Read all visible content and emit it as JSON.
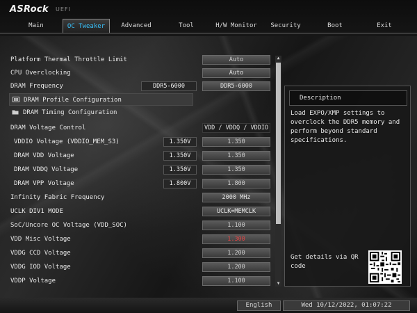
{
  "header": {
    "logo": "ASRock",
    "uefi": "UEFI"
  },
  "tabs": [
    {
      "label": "Main"
    },
    {
      "label": "OC Tweaker",
      "active": true
    },
    {
      "label": "Advanced"
    },
    {
      "label": "Tool"
    },
    {
      "label": "H/W Monitor"
    },
    {
      "label": "Security"
    },
    {
      "label": "Boot"
    },
    {
      "label": "Exit"
    }
  ],
  "settings": [
    {
      "label": "Platform Thermal Throttle Limit",
      "value": "Auto"
    },
    {
      "label": "CPU Overclocking",
      "value": "Auto"
    },
    {
      "label": "DRAM Frequency",
      "current": "DDR5-6000",
      "value": "DDR5-6000"
    },
    {
      "label": "DRAM Profile Configuration",
      "type": "submenu",
      "selected": true
    },
    {
      "label": "DRAM Timing Configuration",
      "type": "submenu"
    },
    {
      "label": "DRAM Voltage Control",
      "value": "VDD / VDDQ / VDDIO"
    },
    {
      "label": "VDDIO Voltage (VDDIO_MEM_S3)",
      "current": "1.350V",
      "value": "1.350"
    },
    {
      "label": "DRAM VDD Voltage",
      "current": "1.350V",
      "value": "1.350"
    },
    {
      "label": "DRAM VDDQ Voltage",
      "current": "1.350V",
      "value": "1.350"
    },
    {
      "label": "DRAM VPP Voltage",
      "current": "1.800V",
      "value": "1.800"
    },
    {
      "label": "Infinity Fabric Frequency",
      "value": "2000 MHz"
    },
    {
      "label": "UCLK DIV1 MODE",
      "value": "UCLK=MEMCLK"
    },
    {
      "label": "SoC/Uncore OC Voltage (VDD_SOC)",
      "value": "1.100"
    },
    {
      "label": "VDD Misc Voltage",
      "value": "1.300"
    },
    {
      "label": "VDDG CCD Voltage",
      "value": "1.200"
    },
    {
      "label": "VDDG IOD Voltage",
      "value": "1.200"
    },
    {
      "label": "VDDP Voltage",
      "value": "1.100"
    }
  ],
  "description": {
    "title": "Description",
    "text": "Load EXPO/XMP settings to\noverclock the DDR5 memory and\nperform beyond standard\nspecifications.",
    "qr_text": "Get details via QR code"
  },
  "footer": {
    "language": "English",
    "datetime": "Wed 10/12/2022, 01:07:22"
  },
  "colors": {
    "active_tab": "#39c4ff",
    "warning_value": "#e04545"
  }
}
